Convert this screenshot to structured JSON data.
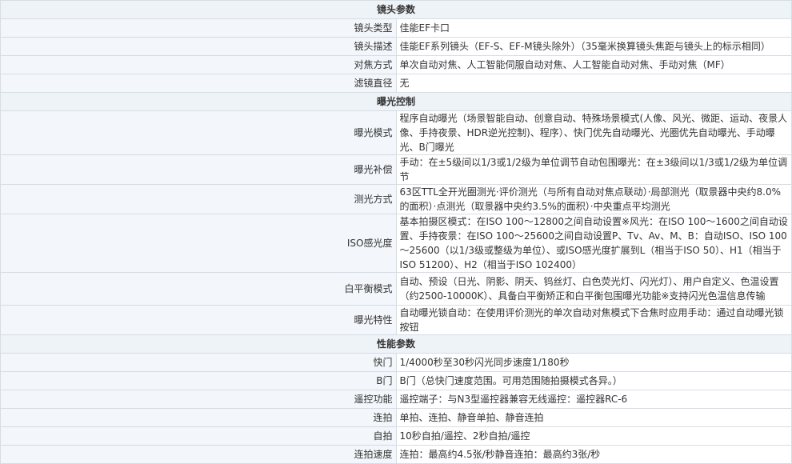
{
  "sections": [
    {
      "title": "镜头参数",
      "rows": [
        {
          "label": "镜头类型",
          "value": "佳能EF卡口"
        },
        {
          "label": "镜头描述",
          "value": "佳能EF系列镜头（EF-S、EF-M镜头除外）（35毫米换算镜头焦距与镜头上的标示相同）"
        },
        {
          "label": "对焦方式",
          "value": "单次自动对焦、人工智能伺服自动对焦、人工智能自动对焦、手动对焦（MF）"
        },
        {
          "label": "滤镜直径",
          "value": "无"
        }
      ]
    },
    {
      "title": "曝光控制",
      "rows": [
        {
          "label": "曝光模式",
          "value": "程序自动曝光（场景智能自动、创意自动、特殊场景模式(人像、风光、微距、运动、夜景人像、手持夜景、HDR逆光控制)、程序）、快门优先自动曝光、光圈优先自动曝光、手动曝光、B门曝光"
        },
        {
          "label": "曝光补偿",
          "value": "手动：在±5级间以1/3或1/2级为单位调节自动包围曝光：在±3级间以1/3或1/2级为单位调节"
        },
        {
          "label": "测光方式",
          "value": "63区TTL全开光圈测光·评价测光（与所有自动对焦点联动）·局部测光（取景器中央约8.0%的面积）·点测光（取景器中央约3.5%的面积）·中央重点平均测光"
        },
        {
          "label": "ISO感光度",
          "value": "基本拍摄区模式：在ISO 100～12800之间自动设置※风光：在ISO 100～1600之间自动设置、手持夜景：在ISO 100～25600之间自动设置P、Tv、Av、M、B：自动ISO、ISO 100～25600（以1/3级或整级为单位）、或ISO感光度扩展到L（相当于ISO 50）、H1（相当于ISO 51200）、H2（相当于ISO 102400）"
        },
        {
          "label": "白平衡模式",
          "value": "自动、预设（日光、阴影、阴天、钨丝灯、白色荧光灯、闪光灯）、用户自定义、色温设置（约2500-10000K）、具备白平衡矫正和白平衡包围曝光功能※支持闪光色温信息传输"
        },
        {
          "label": "曝光特性",
          "value": "自动曝光锁自动：在使用评价测光的单次自动对焦模式下合焦时应用手动：通过自动曝光锁按钮"
        }
      ]
    },
    {
      "title": "性能参数",
      "rows": [
        {
          "label": "快门",
          "value": "1/4000秒至30秒闪光同步速度1/180秒"
        },
        {
          "label": "B门",
          "value": "B门（总快门速度范围。可用范围随拍摄模式各异。）"
        },
        {
          "label": "遥控功能",
          "value": "遥控端子：与N3型遥控器兼容无线遥控：遥控器RC-6"
        },
        {
          "label": "连拍",
          "value": "单拍、连拍、静音单拍、静音连拍"
        },
        {
          "label": "自拍",
          "value": "10秒自拍/遥控、2秒自拍/遥控"
        },
        {
          "label": "连拍速度",
          "value": "连拍：最高约4.5张/秒静音连拍：最高约3张/秒"
        }
      ]
    }
  ]
}
